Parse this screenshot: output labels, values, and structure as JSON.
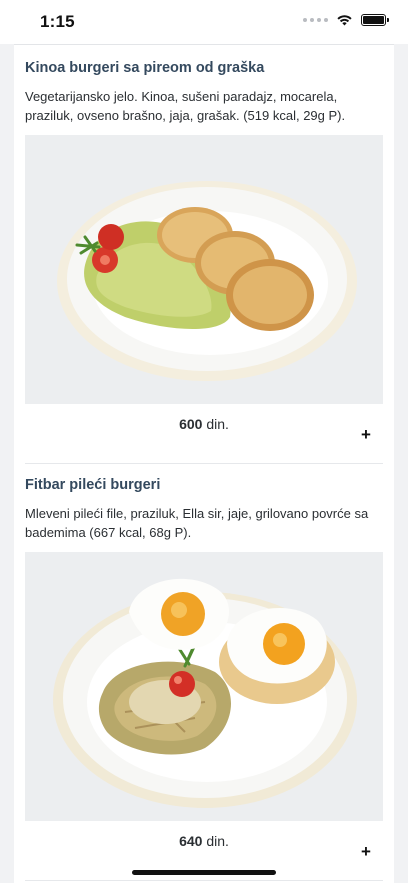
{
  "status_bar": {
    "time": "1:15",
    "icons": [
      "signal-dots-icon",
      "wifi-icon",
      "battery-icon"
    ]
  },
  "menu_items": [
    {
      "title": "Kinoa burgeri sa pireom od graška",
      "description": "Vegetarijansko jelo. Kinoa, sušeni paradajz, mocarela, praziluk, ovseno brašno, jaja, grašak. (519 kcal, 29g P).",
      "image_alt": "",
      "price_amount": "600",
      "price_currency": "din.",
      "add_icon": "plus-icon",
      "add_label": "+"
    },
    {
      "title": "Fitbar pileći burgeri",
      "description": "Mleveni pileći file, praziluk, Ella sir, jaje, grilovano povrće sa bademima (667 kcal, 68g P).",
      "image_alt": "",
      "price_amount": "640",
      "price_currency": "din.",
      "add_icon": "plus-icon",
      "add_label": "+"
    }
  ],
  "colors": {
    "title": "#34495e",
    "background": "#f1f2f4",
    "card": "#ffffff"
  }
}
